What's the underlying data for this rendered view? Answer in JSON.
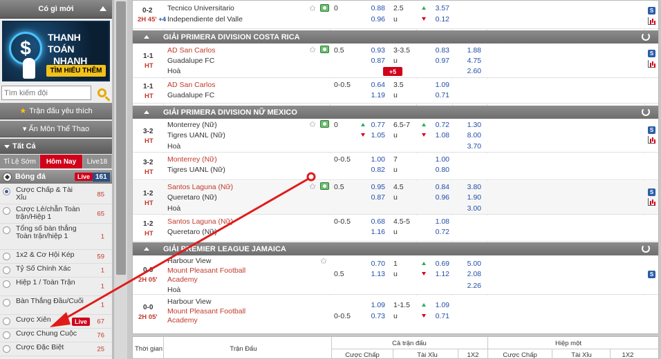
{
  "sidebar": {
    "header": "Có gì mới",
    "banner": {
      "line1": "THANH TOÁN",
      "line2": "NHANH",
      "button": "TÌM HIỂU THÊM",
      "symbol": "$"
    },
    "search": {
      "placeholder": "Tìm kiếm đội"
    },
    "favorites": "Trận đấu yêu thích",
    "hide_sports": "▾ Ẩn Môn Thể Thao",
    "all": "Tất Cả",
    "tabs": [
      "Tỉ Lệ Sớm",
      "Hôm Nay",
      "Live18"
    ],
    "football": {
      "label": "Bóng đá",
      "live": "Live",
      "count": "161"
    },
    "menu": [
      {
        "label": "Cược Chấp & Tài Xỉu",
        "count": "85",
        "selected": true
      },
      {
        "label": "Cược Lẻ/chẵn Toàn trận/Hiệp 1",
        "count": "65"
      },
      {
        "label": "Tổng số bàn thắng Toàn trận/hiệp 1",
        "count": "1"
      },
      {
        "label": "1x2 & Cơ Hội Kép",
        "count": "59"
      },
      {
        "label": "Tỷ Số Chính Xác",
        "count": "1"
      },
      {
        "label": "Hiệp 1 / Toàn Trận",
        "count": "1"
      },
      {
        "label": "Bàn Thắng Đầu/Cuối",
        "count": "1"
      },
      {
        "label": "Cược Xiên",
        "count": "67",
        "live": "Live"
      },
      {
        "label": "Cược Chung Cuộc",
        "count": "76"
      },
      {
        "label": "Cược Đặc Biệt",
        "count": "25"
      }
    ]
  },
  "leagues": [
    {
      "name": "GIẢI PRIMERA DIVISION COSTA RICA"
    },
    {
      "name": "GIẢI PRIMERA DIVISION NỮ MEXICO"
    },
    {
      "name": "GIẢI PREMIER LEAGUE JAMAICA"
    }
  ],
  "matches": {
    "m0": {
      "score": "0-2",
      "time": "2H 45'",
      "extra": "+4",
      "home": "Tecnico Universitario",
      "away": "Independiente del Valle",
      "hdp": "0",
      "h1": "0.88",
      "h2": "0.96",
      "ou": "2.5",
      "ou_u": "u",
      "o1": "3.57",
      "o2": "0.12"
    },
    "m1": {
      "score": "1-1",
      "time": "HT",
      "home": "AD San Carlos",
      "away": "Guadalupe FC",
      "draw": "Hoà",
      "hdp": "0.5",
      "h1": "0.93",
      "h2": "0.87",
      "ou": "3-3.5",
      "ou_u": "u",
      "o1": "0.83",
      "o2": "0.97",
      "x1": "1.88",
      "x2": "4.75",
      "x3": "2.60",
      "bonus": "+5"
    },
    "m2": {
      "score": "1-1",
      "time": "HT",
      "home": "AD San Carlos",
      "away": "Guadalupe FC",
      "hdp": "0-0.5",
      "h1": "0.64",
      "h2": "1.19",
      "ou": "3.5",
      "ou_u": "u",
      "o1": "1.09",
      "o2": "0.71"
    },
    "m3": {
      "score": "3-2",
      "time": "HT",
      "home": "Monterrey (Nữ)",
      "away": "Tigres UANL (Nữ)",
      "draw": "Hoà",
      "hdp": "0",
      "h1": "0.77",
      "h2": "1.05",
      "ou": "6.5-7",
      "ou_u": "u",
      "o1": "0.72",
      "o2": "1.08",
      "x1": "1.30",
      "x2": "8.00",
      "x3": "3.70"
    },
    "m4": {
      "score": "3-2",
      "time": "HT",
      "home": "Monterrey (Nữ)",
      "away": "Tigres UANL (Nữ)",
      "hdp": "0-0.5",
      "h1": "1.00",
      "h2": "0.82",
      "ou": "7",
      "ou_u": "u",
      "o1": "1.00",
      "o2": "0.80"
    },
    "m5": {
      "score": "1-2",
      "time": "HT",
      "home": "Santos Laguna (Nữ)",
      "away": "Queretaro (Nữ)",
      "draw": "Hoà",
      "hdp": "0.5",
      "h1": "0.95",
      "h2": "0.87",
      "ou": "4.5",
      "ou_u": "u",
      "o1": "0.84",
      "o2": "0.96",
      "x1": "3.80",
      "x2": "1.90",
      "x3": "3.00"
    },
    "m6": {
      "score": "1-2",
      "time": "HT",
      "home": "Santos Laguna (Nữ)",
      "away": "Queretaro (Nữ)",
      "hdp": "0-0.5",
      "h1": "0.68",
      "h2": "1.16",
      "ou": "4.5-5",
      "ou_u": "u",
      "o1": "1.08",
      "o2": "0.72"
    },
    "m7": {
      "score": "0-0",
      "time": "2H 05'",
      "home": "Harbour View",
      "away": "Mount Pleasant Football Academy",
      "away_l1": "Mount Pleasant Football",
      "away_l2": "Academy",
      "draw": "Hoà",
      "hdp": "0.5",
      "h1": "0.70",
      "h2": "1.13",
      "ou": "1",
      "ou_u": "u",
      "o1": "0.69",
      "o2": "1.12",
      "x1": "5.00",
      "x2": "2.08",
      "x3": "2.26"
    },
    "m8": {
      "score": "0-0",
      "time": "2H 05'",
      "home": "Harbour View",
      "away_l1": "Mount Pleasant Football",
      "away_l2": "Academy",
      "hdp": "0-0.5",
      "h1": "1.09",
      "h2": "0.73",
      "ou": "1-1.5",
      "ou_u": "u",
      "o1": "1.09",
      "o2": "0.71"
    }
  },
  "footer": {
    "time": "Thời gian",
    "match": "Trận Đấu",
    "full": "Cả trận đấu",
    "half": "Hiệp một",
    "hdp": "Cược Chấp",
    "ou": "Tài Xỉu",
    "x12": "1X2"
  },
  "colors": {
    "live_red": "#d0021b",
    "header_gray": "#6e6e6e",
    "odds_blue": "#1f4ea8",
    "team_red": "#c0392b"
  }
}
